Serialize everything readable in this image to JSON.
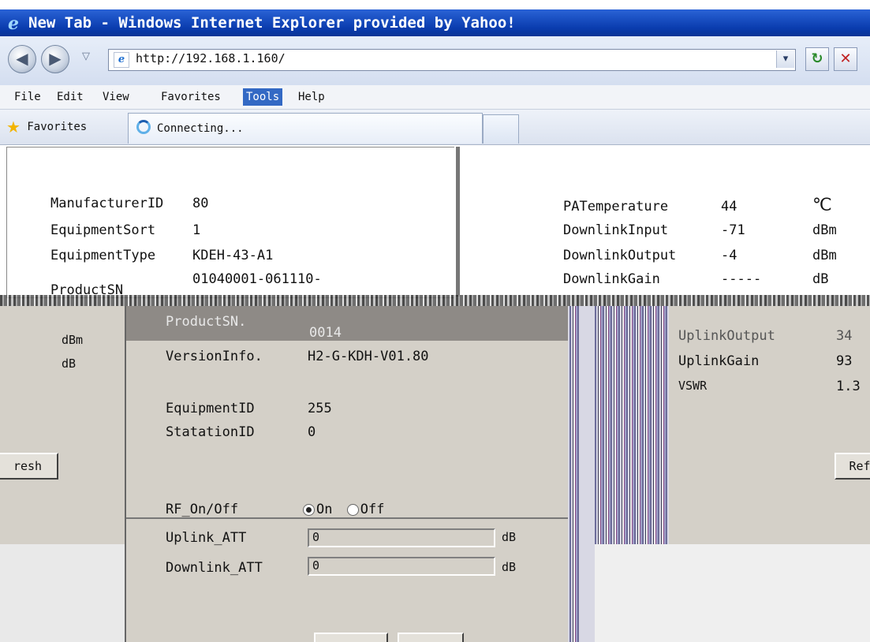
{
  "window": {
    "title": "New Tab - Windows Internet Explorer provided by Yahoo!"
  },
  "nav": {
    "url": "http://192.168.1.160/",
    "dropdown_glyph": "▾",
    "refresh_glyph": "↻",
    "stop_glyph": "✕",
    "back_glyph": "◀",
    "forward_glyph": "▶",
    "history_glyph": "▽"
  },
  "menu": {
    "items": [
      "File",
      "Edit",
      "View",
      "Favorites",
      "Tools",
      "Help"
    ],
    "active": "Tools"
  },
  "favorites": {
    "label": "Favorites",
    "tab_label": "Connecting..."
  },
  "top_left": {
    "rows": [
      {
        "label": "ManufacturerID",
        "value": "80"
      },
      {
        "label": "EquipmentSort",
        "value": "1"
      },
      {
        "label": "EquipmentType",
        "value": "KDEH-43-A1"
      },
      {
        "label": "ProductSN",
        "value": "01040001-061110-"
      }
    ]
  },
  "top_right": {
    "rows": [
      {
        "label": "PATemperature",
        "value": "44",
        "unit": "℃"
      },
      {
        "label": "DownlinkInput",
        "value": "-71",
        "unit": "dBm"
      },
      {
        "label": "DownlinkOutput",
        "value": "-4",
        "unit": "dBm"
      },
      {
        "label": "DownlinkGain",
        "value": "-----",
        "unit": "dB"
      }
    ]
  },
  "lower_left": {
    "unit1": "dBm",
    "unit2": "dB",
    "refresh_label": "resh"
  },
  "lower_center": {
    "product_sn_label": "ProductSN.",
    "product_sn_value": "0014",
    "version_label": "VersionInfo.",
    "version_value": "H2-G-KDH-V01.80",
    "equipment_id_label": "EquipmentID",
    "equipment_id_value": "255",
    "station_id_label": "StatationID",
    "station_id_value": "0",
    "rf_label": "RF_On/Off",
    "rf_on": "On",
    "rf_off": "Off",
    "uplink_att_label": "Uplink_ATT",
    "uplink_att_value": "0",
    "uplink_att_unit": "dB",
    "downlink_att_label": "Downlink_ATT",
    "downlink_att_value": "0",
    "downlink_att_unit": "dB"
  },
  "lower_right": {
    "rows": [
      {
        "label": "UplinkOutput",
        "value": "34"
      },
      {
        "label": "UplinkGain",
        "value": "93"
      },
      {
        "label": "VSWR",
        "value": "1.3"
      }
    ],
    "refresh_label": "Ref"
  }
}
